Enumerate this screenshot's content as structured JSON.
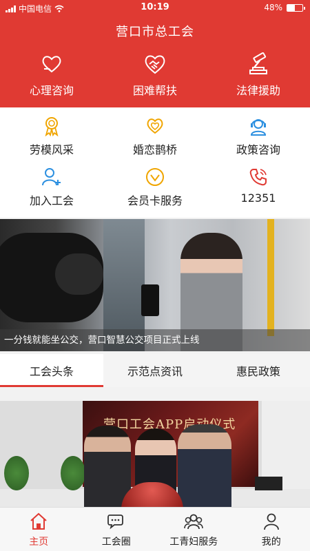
{
  "status_bar": {
    "carrier": "中国电信",
    "time": "10:19",
    "battery": "48%",
    "battery_level": 0.48
  },
  "header": {
    "title": "营口市总工会"
  },
  "top_services": [
    {
      "label": "心理咨询",
      "icon": "heart-hand-icon"
    },
    {
      "label": "困难帮扶",
      "icon": "handshake-icon"
    },
    {
      "label": "法律援助",
      "icon": "gavel-icon"
    }
  ],
  "services": [
    {
      "label": "劳模风采",
      "icon": "medal-icon",
      "color": "#f0a500"
    },
    {
      "label": "婚恋鹊桥",
      "icon": "double-heart-icon",
      "color": "#f0a500"
    },
    {
      "label": "政策咨询",
      "icon": "headset-icon",
      "color": "#2b8fe0"
    },
    {
      "label": "加入工会",
      "icon": "add-user-icon",
      "color": "#2b8fe0"
    },
    {
      "label": "会员卡服务",
      "icon": "diamond-card-icon",
      "color": "#f0a500"
    },
    {
      "label": "12351",
      "icon": "phone-icon",
      "color": "#e03a33"
    }
  ],
  "banner": {
    "caption": "一分钱就能坐公交，营口智慧公交项目正式上线"
  },
  "tabs": [
    {
      "label": "工会头条",
      "active": true
    },
    {
      "label": "示范点资讯",
      "active": false
    },
    {
      "label": "惠民政策",
      "active": false
    }
  ],
  "news": {
    "screen_text": "营口工会APP启动仪式"
  },
  "bottom_nav": [
    {
      "label": "主页",
      "icon": "home-icon",
      "active": true
    },
    {
      "label": "工会圈",
      "icon": "chat-icon",
      "active": false
    },
    {
      "label": "工青妇服务",
      "icon": "group-icon",
      "active": false
    },
    {
      "label": "我的",
      "icon": "user-icon",
      "active": false
    }
  ],
  "colors": {
    "brand_red": "#e03a33",
    "accent_gold": "#f0a500",
    "accent_blue": "#2b8fe0"
  }
}
